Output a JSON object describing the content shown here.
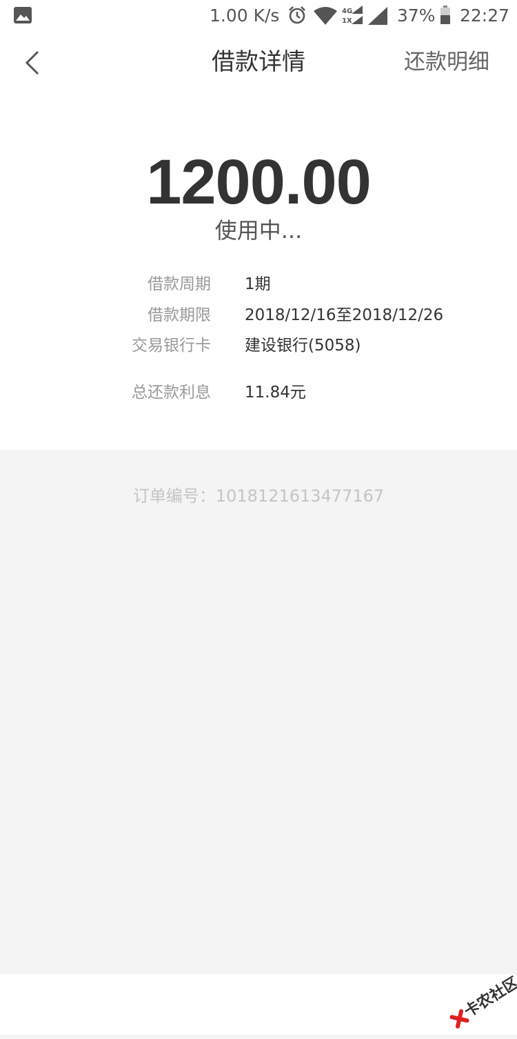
{
  "status_bar": {
    "net_speed": "1.00 K/s",
    "battery_percent": "37%",
    "time": "22:27",
    "icons": [
      "gallery-icon",
      "alarm-icon",
      "wifi-icon",
      "cell-4g-icon",
      "signal-icon",
      "battery-icon"
    ]
  },
  "nav": {
    "back_icon": "chevron-left-icon",
    "title": "借款详情",
    "right_link": "还款明细"
  },
  "loan": {
    "amount": "1200.00",
    "status": "使用中..."
  },
  "details": {
    "period": {
      "label": "借款周期",
      "value": "1期"
    },
    "term": {
      "label": "借款期限",
      "value": "2018/12/16至2018/12/26"
    },
    "card": {
      "label": "交易银行卡",
      "value": "建设银行(5058)"
    },
    "interest": {
      "label": "总还款利息",
      "value": "11.84元"
    }
  },
  "order": {
    "label": "订单编号：",
    "number": "1018121613477167"
  },
  "watermark": {
    "text": "卡农社区",
    "logo_color": "#e02020"
  },
  "colors": {
    "page_background": "#f4f4f4",
    "card_background": "#ffffff",
    "primary_text": "#333333",
    "label_text": "#999999",
    "muted_text": "#c4c4c4"
  }
}
